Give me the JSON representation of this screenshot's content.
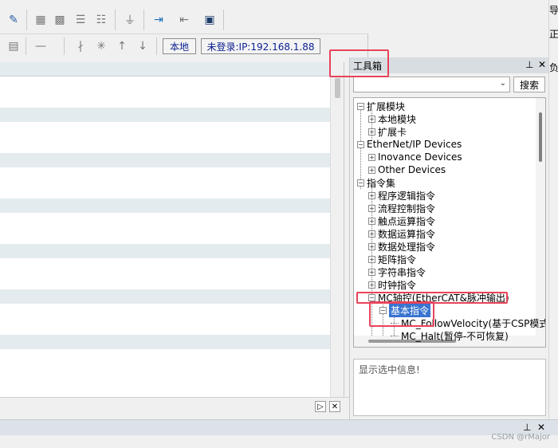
{
  "toolbar": {
    "status_local": "本地",
    "status_login": "未登录:IP:192.168.1.88"
  },
  "toolbox": {
    "title": "工具箱",
    "pin": "ㅁ",
    "close": "✕",
    "search_label": "搜索",
    "info_text": "显示选中信息!"
  },
  "tree": [
    {
      "label": "扩展模块",
      "level": 0,
      "sign": "−"
    },
    {
      "label": "本地模块",
      "level": 1,
      "sign": "+"
    },
    {
      "label": "扩展卡",
      "level": 1,
      "sign": "+"
    },
    {
      "label": "EtherNet/IP Devices",
      "level": 0,
      "sign": "−"
    },
    {
      "label": "Inovance Devices",
      "level": 1,
      "sign": "+"
    },
    {
      "label": "Other Devices",
      "level": 1,
      "sign": "+"
    },
    {
      "label": "指令集",
      "level": 0,
      "sign": "−"
    },
    {
      "label": "程序逻辑指令",
      "level": 1,
      "sign": "+"
    },
    {
      "label": "流程控制指令",
      "level": 1,
      "sign": "+"
    },
    {
      "label": "触点运算指令",
      "level": 1,
      "sign": "+"
    },
    {
      "label": "数据运算指令",
      "level": 1,
      "sign": "+"
    },
    {
      "label": "数据处理指令",
      "level": 1,
      "sign": "+"
    },
    {
      "label": "矩阵指令",
      "level": 1,
      "sign": "+"
    },
    {
      "label": "字符串指令",
      "level": 1,
      "sign": "+"
    },
    {
      "label": "时钟指令",
      "level": 1,
      "sign": "+"
    },
    {
      "label": "MC轴控(EtherCAT&脉冲输出)",
      "level": 1,
      "sign": "−"
    },
    {
      "label": "基本指令",
      "level": 2,
      "sign": "−",
      "selected": true
    },
    {
      "label": "MC_FollowVelocity(基于CSP模式",
      "level": 3,
      "sign": ""
    },
    {
      "label": "MC_Halt(暂停-不可恢复)",
      "level": 3,
      "sign": ""
    }
  ],
  "colors": {
    "highlight": "#e8435a",
    "selection": "#3874d0",
    "status_text": "#0a1e90"
  },
  "watermark": "CSDN @rMajor",
  "right_edge": {
    "char1": "导",
    "char2": "正",
    "char3": "负"
  }
}
